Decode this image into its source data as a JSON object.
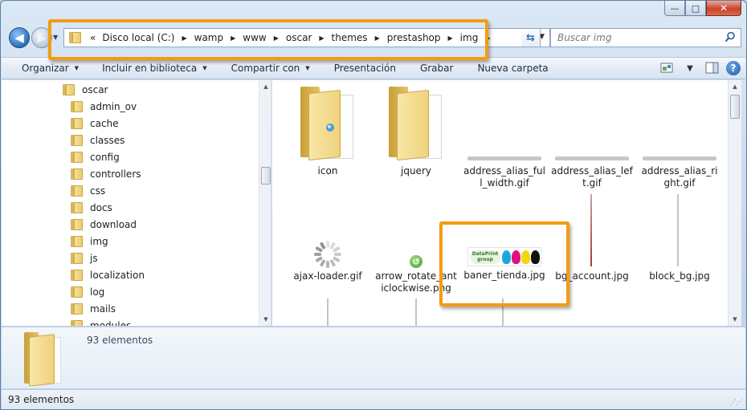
{
  "window": {
    "minimize_glyph": "—",
    "maximize_glyph": "□",
    "close_glyph": "✕"
  },
  "address": {
    "overflow_glyph": "«",
    "crumbs": [
      "Disco local (C:)",
      "wamp",
      "www",
      "oscar",
      "themes",
      "prestashop",
      "img"
    ]
  },
  "search": {
    "placeholder": "Buscar img"
  },
  "toolbar": {
    "organize": "Organizar",
    "include_library": "Incluir en biblioteca",
    "share_with": "Compartir con",
    "presentation": "Presentación",
    "burn": "Grabar",
    "new_folder": "Nueva carpeta",
    "help": "?"
  },
  "tree": {
    "parent": "oscar",
    "items": [
      "admin_ov",
      "cache",
      "classes",
      "config",
      "controllers",
      "css",
      "docs",
      "download",
      "img",
      "js",
      "localization",
      "log",
      "mails",
      "modules"
    ]
  },
  "files": {
    "row1": [
      {
        "label": "icon",
        "kind": "folder"
      },
      {
        "label": "jquery",
        "kind": "folder"
      },
      {
        "label": "address_alias_full_width.gif",
        "kind": "bar"
      },
      {
        "label": "address_alias_left.gif",
        "kind": "bar"
      },
      {
        "label": "address_alias_right.gif",
        "kind": "bar"
      }
    ],
    "row2": [
      {
        "label": "ajax-loader.gif",
        "kind": "spinner"
      },
      {
        "label": "arrow_rotate_anticlockwise.png",
        "kind": "arrow"
      },
      {
        "label": "baner_tienda.jpg",
        "kind": "banner"
      },
      {
        "label": "bg_account.jpg",
        "kind": "line"
      },
      {
        "label": "block_bg.jpg",
        "kind": "line"
      }
    ],
    "banner_logo_text": "DataPrint group"
  },
  "details": {
    "count": "93 elementos"
  },
  "status": {
    "count": "93 elementos"
  },
  "colors": {
    "highlight": "#f39c12",
    "ink": [
      "#1aa7e0",
      "#e2127a",
      "#f5d60a",
      "#111111"
    ]
  }
}
